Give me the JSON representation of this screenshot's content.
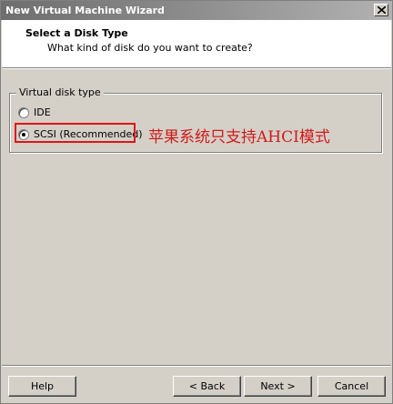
{
  "window": {
    "title": "New Virtual Machine Wizard"
  },
  "header": {
    "title": "Select a Disk Type",
    "subtitle": "What kind of disk do you want to create?"
  },
  "disk_type_group": {
    "legend": "Virtual disk type",
    "options": [
      {
        "label": "IDE",
        "selected": false
      },
      {
        "label": "SCSI (Recommended)",
        "selected": true
      }
    ]
  },
  "annotation": {
    "text": "苹果系统只支持AHCI模式",
    "color": "#d01a1a",
    "highlight_color": "#e01414"
  },
  "footer": {
    "help_label": "Help",
    "back_label": "< Back",
    "next_label": "Next >",
    "cancel_label": "Cancel"
  }
}
